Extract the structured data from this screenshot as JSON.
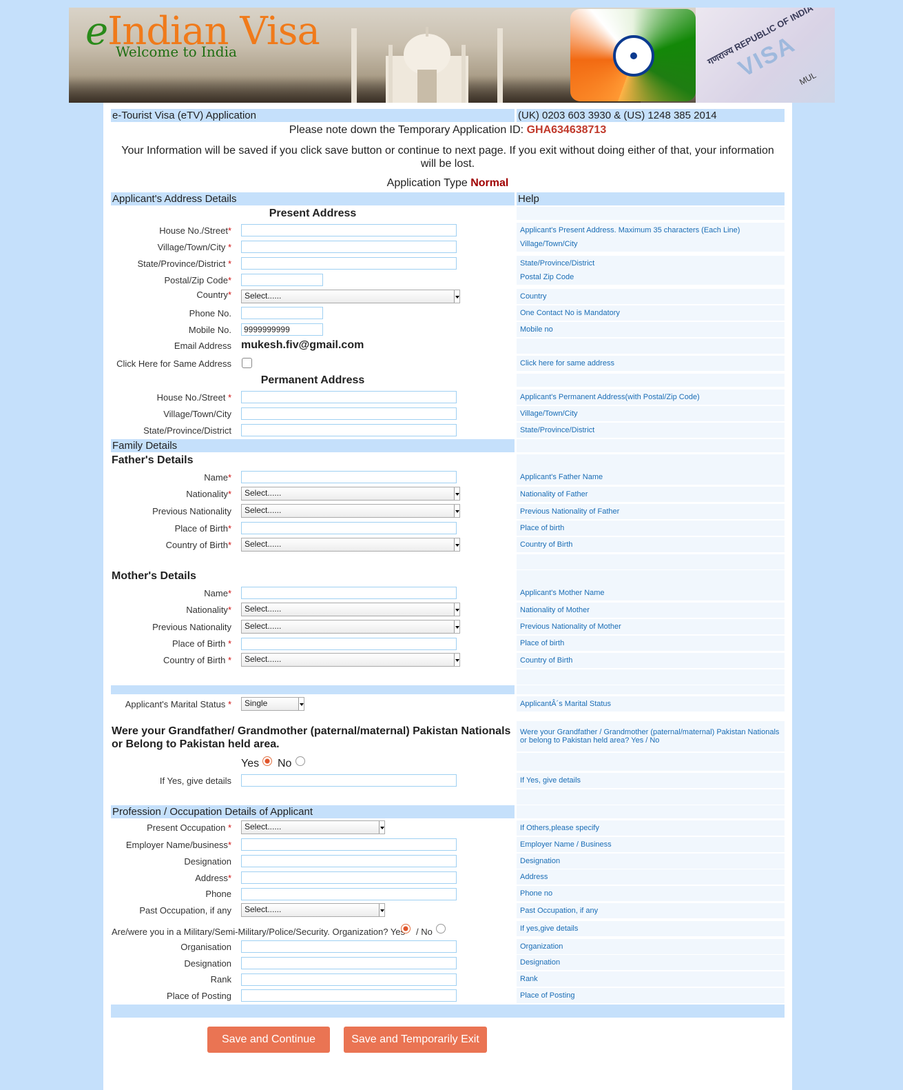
{
  "banner": {
    "logo_e": "e",
    "logo_rest": "Indian Visa",
    "welcome": "Welcome to India",
    "stamp_republic": "गणराज्य REPUBLIC OF INDIA",
    "stamp_visa": "VISA",
    "stamp_multi": "MUL"
  },
  "header": {
    "title": "e-Tourist Visa (eTV) Application",
    "phones": "(UK) 0203 603 3930 & (US) 1248 385 2014"
  },
  "notice": {
    "id_label": "Please note down the Temporary Application ID:",
    "id_value": "GHA634638713",
    "save_info": "Your Information will be saved if you click save button or continue to next page. If you exit without doing either of that, your information will be lost.",
    "type_label": "Application Type",
    "type_value": "Normal"
  },
  "address": {
    "section": "Applicant's Address Details",
    "help_header": "Help",
    "present_title": "Present Address",
    "house": "House No./Street",
    "house_help": "Applicant's Present Address. Maximum 35 characters (Each Line)",
    "village": "Village/Town/City ",
    "village_help": "Village/Town/City",
    "state": "State/Province/District ",
    "state_help": "State/Province/District",
    "postal": "Postal/Zip Code",
    "postal_help": "Postal Zip Code",
    "country": "Country",
    "country_value": "Select......",
    "country_help": "Country",
    "phone": "Phone No.",
    "phone_help": "One Contact No is Mandatory",
    "mobile": "Mobile No.",
    "mobile_value": "9999999999",
    "mobile_help": "Mobile no",
    "email": "Email Address",
    "email_value": "mukesh.fiv@gmail.com",
    "same": "Click Here for Same Address",
    "same_help": "Click here for same address",
    "permanent_title": "Permanent Address",
    "p_house": "House No./Street ",
    "p_house_help": "Applicant's Permanent Address(with Postal/Zip Code)",
    "p_village": "Village/Town/City",
    "p_village_help": "Village/Town/City",
    "p_state": "State/Province/District",
    "p_state_help": "State/Province/District"
  },
  "family": {
    "section": "Family Details",
    "father_title": "Father's Details",
    "mother_title": "Mother's Details",
    "name": "Name",
    "nationality": "Nationality",
    "prev_nat": "Previous Nationality",
    "pob": "Place of Birth",
    "pob2": "Place of Birth ",
    "cob": "Country of Birth",
    "cob2": "Country of Birth ",
    "select": "Select......",
    "f_name_help": "Applicant's Father Name",
    "f_nat_help": "Nationality of Father",
    "f_prev_help": "Previous Nationality of Father",
    "f_pob_help": "Place of birth",
    "f_cob_help": "Country of Birth",
    "m_name_help": "Applicant's Mother Name",
    "m_nat_help": "Nationality of Mother",
    "m_prev_help": "Previous Nationality of Mother",
    "m_pob_help": "Place of birth",
    "m_cob_help": "Country of Birth"
  },
  "marital": {
    "label": "Applicant's Marital Status ",
    "value": "Single",
    "help": "ApplicantÂ´s Marital Status"
  },
  "pakistan": {
    "question": "Were your Grandfather/ Grandmother (paternal/maternal) Pakistan Nationals or Belong to Pakistan held area.",
    "help": "Were your Grandfather / Grandmother (paternal/maternal) Pakistan Nationals or belong to Pakistan held area? Yes / No",
    "yes": "Yes",
    "no": "No",
    "details": "If Yes, give details",
    "details_help": "If Yes, give details"
  },
  "profession": {
    "section": "Profession / Occupation Details of Applicant",
    "present": "Present Occupation ",
    "present_value": "Select......",
    "present_help": "If Others,please specify",
    "employer": "Employer Name/business",
    "employer_help": "Employer Name / Business",
    "designation": "Designation",
    "designation_help": "Designation",
    "address": "Address",
    "address_help": "Address",
    "phone": "Phone",
    "phone_help": "Phone no",
    "past": "Past Occupation, if any",
    "past_value": "Select......",
    "past_help": "Past Occupation, if any",
    "military": "Are/were you in a Military/Semi-Military/Police/Security. Organization? Yes",
    "military_no": "/ No",
    "military_help": "If yes,give details",
    "org": "Organisation",
    "org_help": "Organization",
    "m_designation": "Designation",
    "m_designation_help": "Designation",
    "rank": "Rank",
    "rank_help": "Rank",
    "posting": "Place of Posting",
    "posting_help": "Place of Posting"
  },
  "buttons": {
    "save_continue": "Save and Continue",
    "save_exit": "Save and Temporarily Exit"
  },
  "colors": {
    "page_bg": "#c5e0fb",
    "accent": "#ea7453",
    "required": "#d01010",
    "app_id": "#c0392b",
    "help_text": "#1a6db5"
  }
}
